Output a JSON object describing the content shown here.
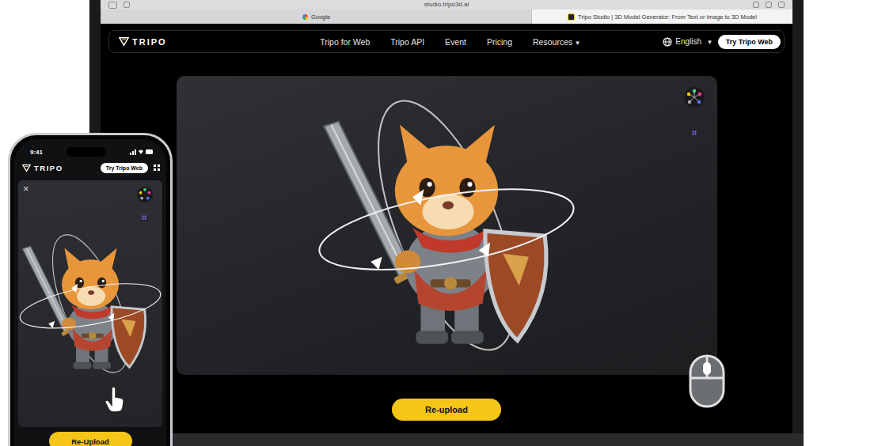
{
  "laptop": {
    "browser": {
      "url": "studio.tripo3d.ai",
      "tabs": [
        {
          "label": "Google",
          "selected": false
        },
        {
          "label": "Tripo Studio | 3D Model Generator: From Text or Image to 3D Model",
          "selected": true
        }
      ]
    },
    "nav": {
      "logo": "TRIPO",
      "caret": "▾",
      "links": [
        {
          "label": "Tripo for Web",
          "dropdown": false
        },
        {
          "label": "Tripo API",
          "dropdown": false
        },
        {
          "label": "Event",
          "dropdown": false
        },
        {
          "label": "Pricing",
          "dropdown": false
        },
        {
          "label": "Resources",
          "dropdown": true
        }
      ],
      "language": {
        "label": "English",
        "dropdown": true
      },
      "cta": "Try Tripo Web"
    },
    "button": "Re-upload"
  },
  "phone": {
    "time": "9:41",
    "logo": "TRIPO",
    "cta": "Try Tripo Web",
    "close": "×",
    "button": "Re-Upload"
  }
}
